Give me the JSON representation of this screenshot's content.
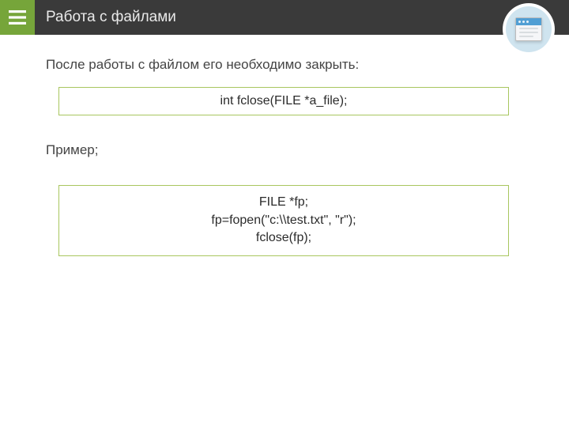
{
  "header": {
    "title": "Работа с файлами"
  },
  "body": {
    "intro": "После работы с файлом его необходимо закрыть:",
    "signature": "int fclose(FILE *a_file);",
    "example_label": "Пример;",
    "example_code": {
      "l1": "FILE *fp;",
      "l2": "fp=fopen(\"c:\\\\test.txt\", \"r\");",
      "l3": "fclose(fp);"
    }
  }
}
